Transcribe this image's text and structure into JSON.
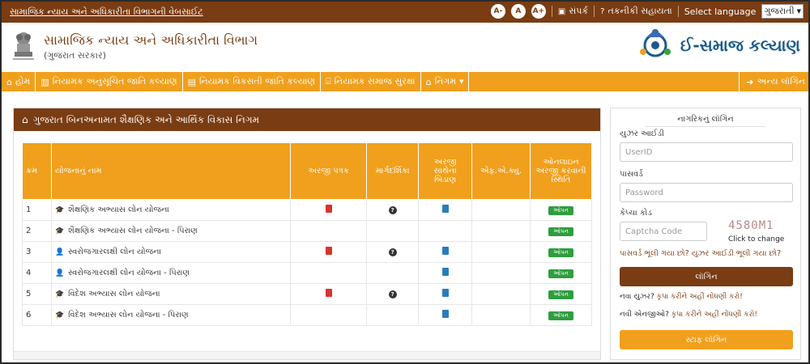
{
  "topbar": {
    "site_link": "સામાજિક ન્યાય અને અધિકારીતા વિભાગની વેબસાઈટ",
    "font_small": "A-",
    "font_normal": "A",
    "font_large": "A+",
    "contact": "સંપર્ક",
    "help": "તકનીકી સહાયતા",
    "select_language": "Select language",
    "language_value": "ગુજરાતી"
  },
  "header": {
    "dept_title": "સામાજિક ન્યાય અને અધિકારીતા વિભાગ",
    "dept_subtitle": "(ગુજરાત સરકાર)",
    "brand": "ઈ-સમાજ કલ્યાણ"
  },
  "nav": {
    "items": [
      {
        "label": "હોમ",
        "icon": "home-icon"
      },
      {
        "label": "નિયામક અનુસૂચિત જાતિ કલ્યાણ",
        "icon": "building-icon"
      },
      {
        "label": "નિયામક વિકસતી જાતિ કલ્યાણ",
        "icon": "book-icon"
      },
      {
        "label": "નિયામક સમાજ સુરક્ષા",
        "icon": "institution-icon"
      },
      {
        "label": "નિગમ",
        "icon": "house-icon"
      }
    ],
    "other_login": "અન્ય લૉગિન"
  },
  "main": {
    "title": "ગુજરાત બિનઅનામત શૈક્ષણિક અને આર્થિક વિકાસ નિગમ",
    "columns": [
      "ક્રમ",
      "યોજનાનું નામ",
      "અરજી પત્રક",
      "માર્ગદર્શિકા",
      "અરજી સાથેના બિડાણ",
      "એફ.એ.ક્યુ.",
      "ઓનલાઇન અરજી કરવાની સ્થિતિ"
    ],
    "rows": [
      {
        "no": "1",
        "name": "શૈક્ષણિક અભ્યાસ લોન યોજના",
        "icon": "graduate-icon",
        "form": true,
        "guide": true,
        "attach": true,
        "status": "ઓપન"
      },
      {
        "no": "2",
        "name": "શૈક્ષણિક અભ્યાસ લોન યોજના - પિરાણ",
        "icon": "graduate-icon",
        "form": false,
        "guide": false,
        "attach": false,
        "status": "ઓપન"
      },
      {
        "no": "3",
        "name": "સ્વરોજગારલક્ષી લોન યોજના",
        "icon": "user-icon",
        "form": true,
        "guide": true,
        "attach": true,
        "status": "ઓપન"
      },
      {
        "no": "4",
        "name": "સ્વરોજગારલક્ષી લોન યોજના - પિરાણ",
        "icon": "user-icon",
        "form": false,
        "guide": false,
        "attach": true,
        "status": "ઓપન"
      },
      {
        "no": "5",
        "name": "વિદેશ અભ્યાસ લોન યોજના",
        "icon": "graduate-icon",
        "form": true,
        "guide": true,
        "attach": true,
        "status": "ઓપન"
      },
      {
        "no": "6",
        "name": "વિદેશ અભ્યાસ લોન યોજના - પિરાણ",
        "icon": "graduate-icon",
        "form": false,
        "guide": false,
        "attach": true,
        "status": "ઓપન"
      }
    ]
  },
  "login": {
    "title": "નાગરિકનું લૉગિન",
    "userid_label": "યુઝર આઈડી",
    "userid_placeholder": "UserID",
    "password_label": "પાસવર્ડ",
    "password_placeholder": "Password",
    "captcha_label": "કેપ્ચા કોડ",
    "captcha_placeholder": "Captcha Code",
    "captcha_text": "4580M1",
    "click_to_change": "Click to change",
    "forgot": "પાસવર્ડ ભૂલી ગયા છો? યુઝર આઈડી ભૂલી ગયા છો?",
    "login_button": "લૉગિન",
    "new_user_q": "નવા યુઝર?",
    "new_user_link": "કૃપા કરીને અહીં નોંધણી કરો!",
    "new_ngo_q": "નવી એનજીઓ?",
    "new_ngo_link": "કૃપા કરીને અહીં નોંધણી કરો!",
    "staff_login": "સ્ટાફ લૉગિન"
  },
  "colors": {
    "brown": "#7a3c12",
    "orange": "#f0a01c",
    "green": "#2e9e3e"
  }
}
